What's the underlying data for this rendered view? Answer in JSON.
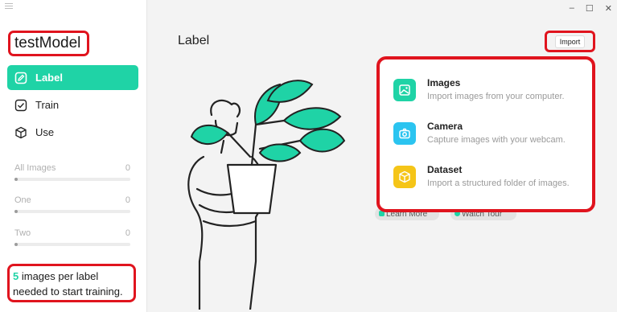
{
  "app": {
    "model_name": "testModel"
  },
  "sidebar": {
    "nav": [
      {
        "label": "Label",
        "icon": "edit-icon",
        "active": true
      },
      {
        "label": "Train",
        "icon": "check-circle-icon",
        "active": false
      },
      {
        "label": "Use",
        "icon": "cube-icon",
        "active": false
      }
    ],
    "labels": [
      {
        "name": "All Images",
        "count": "0"
      },
      {
        "name": "One",
        "count": "0"
      },
      {
        "name": "Two",
        "count": "0"
      }
    ],
    "hint": {
      "count": "5",
      "text": " images per label needed to start training."
    }
  },
  "main": {
    "title": "Label",
    "import_label": "Import",
    "dropdown": [
      {
        "title": "Images",
        "subtitle": "Import images from your computer.",
        "icon": "image-icon",
        "color": "#1fd3a6"
      },
      {
        "title": "Camera",
        "subtitle": "Capture images with your webcam.",
        "icon": "camera-icon",
        "color": "#2bc4f0"
      },
      {
        "title": "Dataset",
        "subtitle": "Import a structured folder of images.",
        "icon": "box-icon",
        "color": "#f5c518"
      }
    ],
    "bottom_buttons": [
      "Learn More",
      "Watch Tour"
    ]
  },
  "window": {
    "minimize": "–",
    "maximize": "☐",
    "close": "✕"
  },
  "colors": {
    "accent": "#1fd3a6",
    "highlight": "#e0141e"
  }
}
